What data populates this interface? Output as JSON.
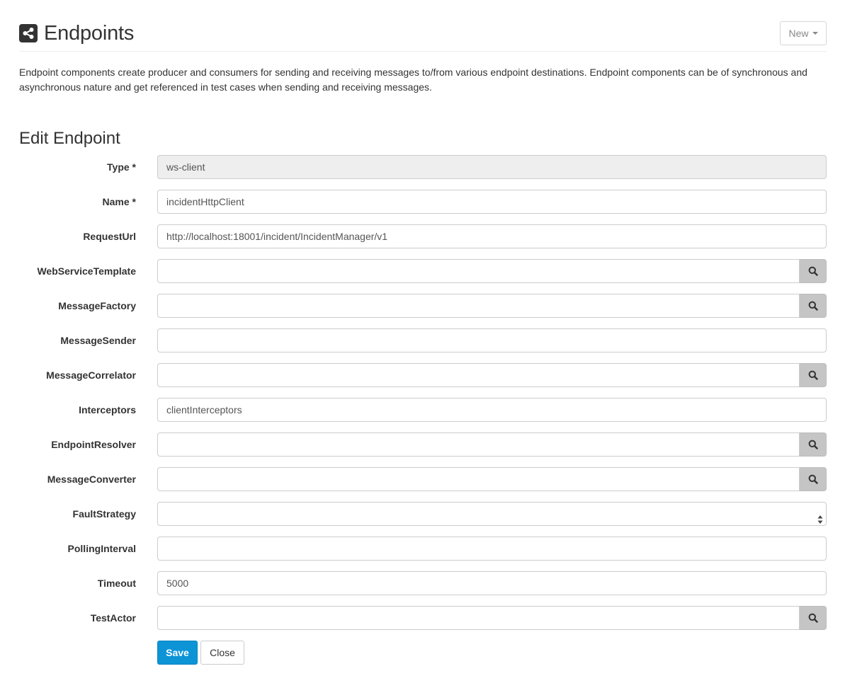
{
  "header": {
    "title": "Endpoints",
    "icon": "share-icon",
    "new_button": "New"
  },
  "description": "Endpoint components create producer and consumers for sending and receiving messages to/from various endpoint destinations. Endpoint components can be of synchronous and asynchronous nature and get referenced in test cases when sending and receiving messages.",
  "form": {
    "title": "Edit Endpoint",
    "fields": [
      {
        "label": "Type *",
        "value": "ws-client",
        "readonly": true
      },
      {
        "label": "Name *",
        "value": "incidentHttpClient"
      },
      {
        "label": "RequestUrl",
        "value": "http://localhost:18001/incident/IncidentManager/v1"
      },
      {
        "label": "WebServiceTemplate",
        "value": "",
        "search": true
      },
      {
        "label": "MessageFactory",
        "value": "",
        "search": true
      },
      {
        "label": "MessageSender",
        "value": ""
      },
      {
        "label": "MessageCorrelator",
        "value": "",
        "search": true
      },
      {
        "label": "Interceptors",
        "value": "clientInterceptors"
      },
      {
        "label": "EndpointResolver",
        "value": "",
        "search": true
      },
      {
        "label": "MessageConverter",
        "value": "",
        "search": true
      },
      {
        "label": "FaultStrategy",
        "value": "",
        "select": true
      },
      {
        "label": "PollingInterval",
        "value": ""
      },
      {
        "label": "Timeout",
        "value": "5000"
      },
      {
        "label": "TestActor",
        "value": "",
        "search": true
      }
    ],
    "save_label": "Save",
    "close_label": "Close"
  },
  "colors": {
    "primary": "#0d94d6",
    "addon": "#c5c5c5",
    "readonly_bg": "#eeeeee"
  }
}
